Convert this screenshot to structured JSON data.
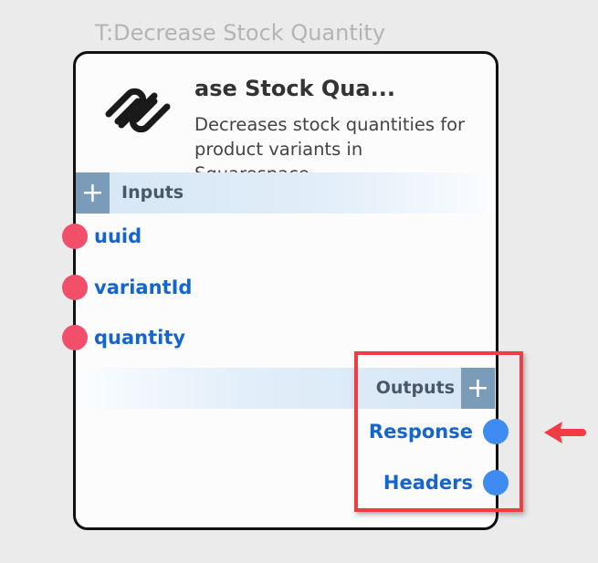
{
  "node": {
    "label": "T:Decrease Stock Quantity",
    "title": "ase Stock Qua...",
    "description": "Decreases stock quantities for product variants in Squarespace",
    "logo": "squarespace-logo"
  },
  "inputs": {
    "label": "Inputs",
    "add_icon": "+",
    "ports": [
      {
        "label": "uuid"
      },
      {
        "label": "variantId"
      },
      {
        "label": "quantity"
      }
    ]
  },
  "outputs": {
    "label": "Outputs",
    "add_icon": "+",
    "ports": [
      {
        "label": "Response"
      },
      {
        "label": "Headers"
      }
    ]
  },
  "colors": {
    "input_port": "#f2506a",
    "output_port": "#3e8bf2",
    "highlight": "#f03c42",
    "port_text": "#1565d0"
  }
}
